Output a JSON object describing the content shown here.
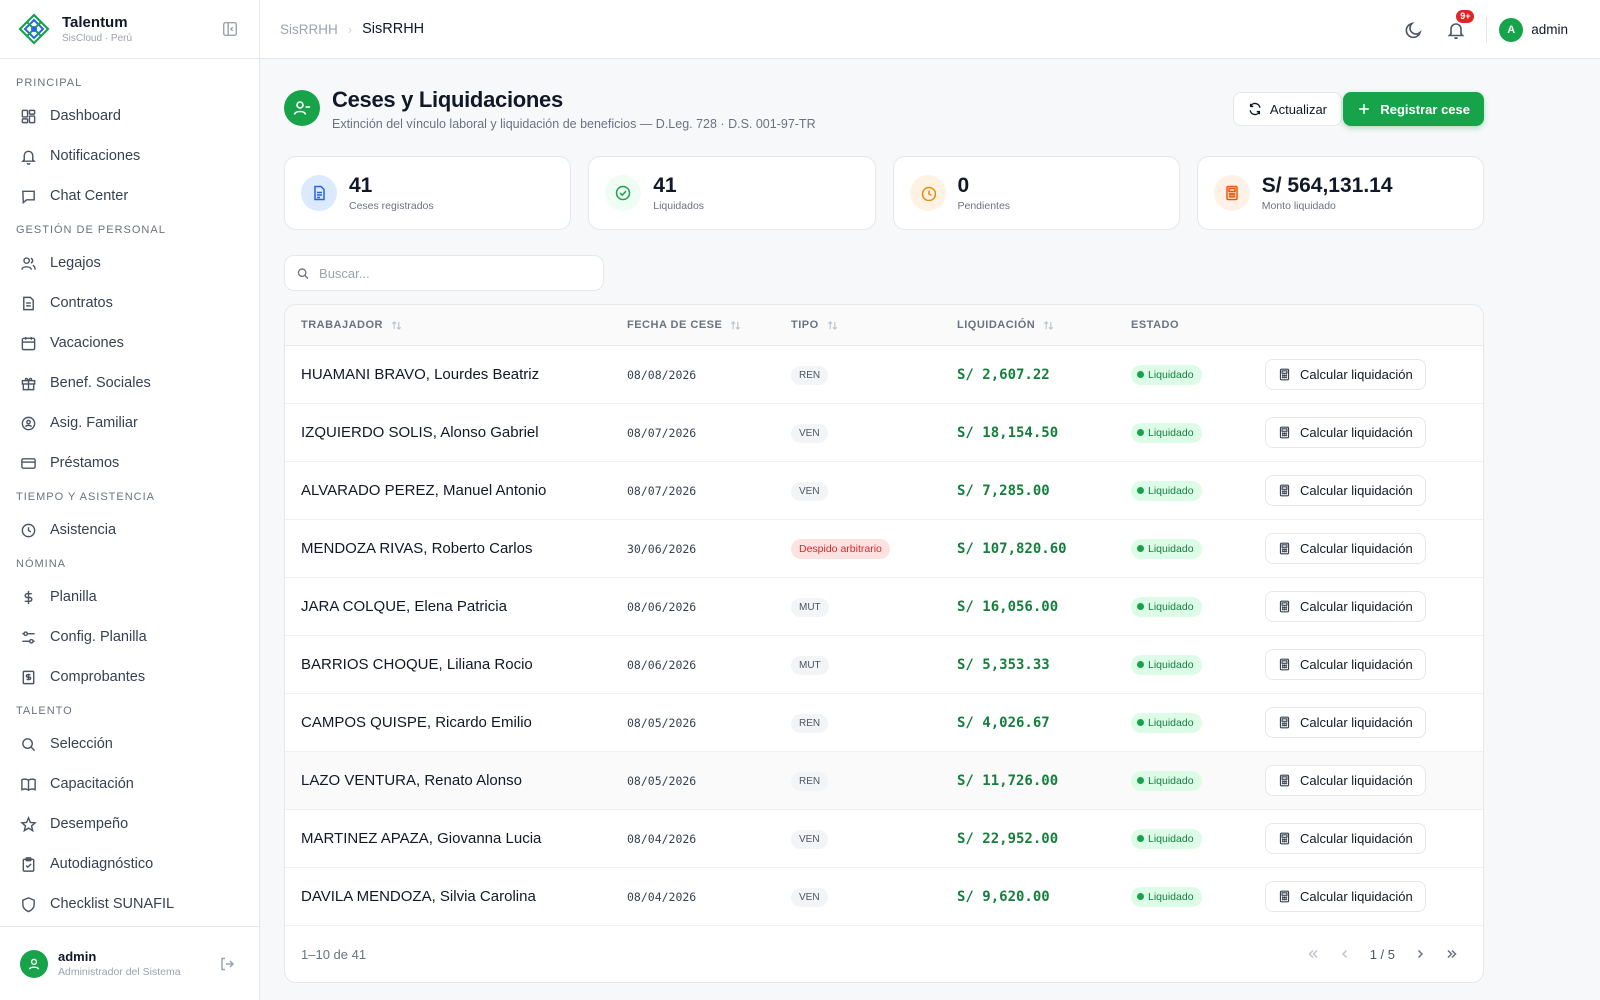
{
  "brand": {
    "name": "Talentum",
    "subtitle": "SisCloud · Perú"
  },
  "sidebar": {
    "sections": [
      {
        "title": "PRINCIPAL",
        "items": [
          {
            "label": "Dashboard",
            "icon": "dashboard-icon"
          },
          {
            "label": "Notificaciones",
            "icon": "bell-icon"
          },
          {
            "label": "Chat Center",
            "icon": "chat-icon"
          }
        ]
      },
      {
        "title": "GESTIÓN DE PERSONAL",
        "items": [
          {
            "label": "Legajos",
            "icon": "users-icon"
          },
          {
            "label": "Contratos",
            "icon": "document-icon"
          },
          {
            "label": "Vacaciones",
            "icon": "calendar-icon"
          },
          {
            "label": "Benef. Sociales",
            "icon": "gift-icon"
          },
          {
            "label": "Asig. Familiar",
            "icon": "family-icon"
          },
          {
            "label": "Préstamos",
            "icon": "card-icon"
          }
        ]
      },
      {
        "title": "TIEMPO Y ASISTENCIA",
        "items": [
          {
            "label": "Asistencia",
            "icon": "clock-icon"
          }
        ]
      },
      {
        "title": "NÓMINA",
        "items": [
          {
            "label": "Planilla",
            "icon": "dollar-icon"
          },
          {
            "label": "Config. Planilla",
            "icon": "sliders-icon"
          },
          {
            "label": "Comprobantes",
            "icon": "receipt-icon"
          }
        ]
      },
      {
        "title": "TALENTO",
        "items": [
          {
            "label": "Selección",
            "icon": "search-icon"
          },
          {
            "label": "Capacitación",
            "icon": "book-icon"
          },
          {
            "label": "Desempeño",
            "icon": "star-icon"
          },
          {
            "label": "Autodiagnóstico",
            "icon": "clipboard-icon"
          },
          {
            "label": "Checklist SUNAFIL",
            "icon": "shield-icon"
          }
        ]
      }
    ],
    "user": {
      "name": "admin",
      "role": "Administrador del Sistema"
    }
  },
  "header": {
    "breadcrumb": [
      "SisRRHH",
      "SisRRHH"
    ],
    "notifications_badge": "9+",
    "avatar_letter": "A",
    "user": "admin"
  },
  "page": {
    "title": "Ceses y Liquidaciones",
    "subtitle": "Extinción del vínculo laboral y liquidación de beneficios — D.Leg. 728 · D.S. 001-97-TR",
    "refresh_label": "Actualizar",
    "primary_label": "Registrar cese"
  },
  "stats": [
    {
      "value": "41",
      "label": "Ceses registrados",
      "icon": "file-icon",
      "bg": "#dbeafe",
      "fg": "#2563eb"
    },
    {
      "value": "41",
      "label": "Liquidados",
      "icon": "check-circle-icon",
      "bg": "#f0fdf4",
      "fg": "#16a34a"
    },
    {
      "value": "0",
      "label": "Pendientes",
      "icon": "clock-icon",
      "bg": "#fef3e2",
      "fg": "#ea8a0c"
    },
    {
      "value": "S/ 564,131.14",
      "label": "Monto liquidado",
      "icon": "calculator-icon",
      "bg": "#fff1e6",
      "fg": "#ea580c"
    }
  ],
  "search": {
    "placeholder": "Buscar..."
  },
  "table": {
    "columns": [
      "TRABAJADOR",
      "FECHA DE CESE",
      "TIPO",
      "LIQUIDACIÓN",
      "ESTADO"
    ],
    "action_label": "Calcular liquidación",
    "rows": [
      {
        "trabajador": "HUAMANI BRAVO, Lourdes Beatriz",
        "fecha": "08/08/2026",
        "tipo": "REN",
        "liquidacion": "S/ 2,607.22",
        "estado": "Liquidado"
      },
      {
        "trabajador": "IZQUIERDO SOLIS, Alonso Gabriel",
        "fecha": "08/07/2026",
        "tipo": "VEN",
        "liquidacion": "S/ 18,154.50",
        "estado": "Liquidado"
      },
      {
        "trabajador": "ALVARADO PEREZ, Manuel Antonio",
        "fecha": "08/07/2026",
        "tipo": "VEN",
        "liquidacion": "S/ 7,285.00",
        "estado": "Liquidado"
      },
      {
        "trabajador": "MENDOZA RIVAS, Roberto Carlos",
        "fecha": "30/06/2026",
        "tipo": "Despido arbitrario",
        "liquidacion": "S/ 107,820.60",
        "estado": "Liquidado"
      },
      {
        "trabajador": "JARA COLQUE, Elena Patricia",
        "fecha": "08/06/2026",
        "tipo": "MUT",
        "liquidacion": "S/ 16,056.00",
        "estado": "Liquidado"
      },
      {
        "trabajador": "BARRIOS CHOQUE, Liliana Rocio",
        "fecha": "08/06/2026",
        "tipo": "MUT",
        "liquidacion": "S/ 5,353.33",
        "estado": "Liquidado"
      },
      {
        "trabajador": "CAMPOS QUISPE, Ricardo Emilio",
        "fecha": "08/05/2026",
        "tipo": "REN",
        "liquidacion": "S/ 4,026.67",
        "estado": "Liquidado"
      },
      {
        "trabajador": "LAZO VENTURA, Renato Alonso",
        "fecha": "08/05/2026",
        "tipo": "REN",
        "liquidacion": "S/ 11,726.00",
        "estado": "Liquidado"
      },
      {
        "trabajador": "MARTINEZ APAZA, Giovanna Lucia",
        "fecha": "08/04/2026",
        "tipo": "VEN",
        "liquidacion": "S/ 22,952.00",
        "estado": "Liquidado"
      },
      {
        "trabajador": "DAVILA MENDOZA, Silvia Carolina",
        "fecha": "08/04/2026",
        "tipo": "VEN",
        "liquidacion": "S/ 9,620.00",
        "estado": "Liquidado"
      }
    ],
    "range": "1–10 de 41",
    "page_label": "1 / 5"
  },
  "colors": {
    "accent": "#16a34a",
    "money": "#15803d",
    "danger": "#dc2626"
  }
}
